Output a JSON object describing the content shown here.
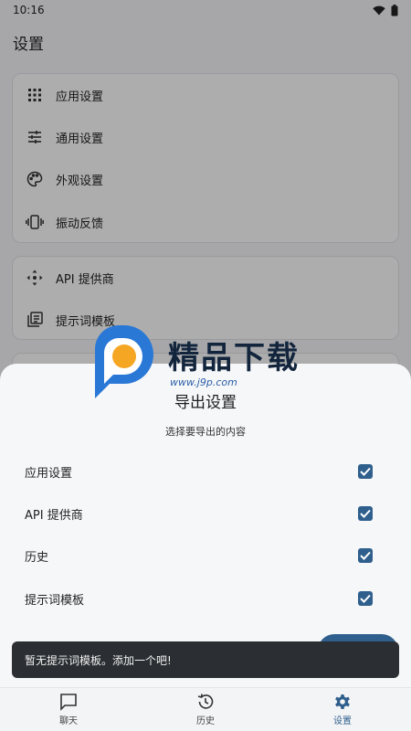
{
  "status_bar": {
    "time": "10:16"
  },
  "page": {
    "title": "设置"
  },
  "settings_card_1": {
    "items": [
      {
        "label": "应用设置",
        "icon": "grid-icon"
      },
      {
        "label": "通用设置",
        "icon": "sliders-icon"
      },
      {
        "label": "外观设置",
        "icon": "palette-icon"
      },
      {
        "label": "振动反馈",
        "icon": "vibration-icon"
      }
    ]
  },
  "settings_card_2": {
    "items": [
      {
        "label": "API 提供商",
        "icon": "api-icon"
      },
      {
        "label": "提示词模板",
        "icon": "template-icon"
      }
    ]
  },
  "watermark": {
    "brand": "精品下载",
    "url": "www.j9p.com"
  },
  "export_sheet": {
    "title": "导出设置",
    "subtitle": "选择要导出的内容",
    "options": [
      {
        "label": "应用设置",
        "checked": true
      },
      {
        "label": "API 提供商",
        "checked": true
      },
      {
        "label": "历史",
        "checked": true
      },
      {
        "label": "提示词模板",
        "checked": true
      }
    ]
  },
  "snackbar": {
    "message": "暂无提示词模板。添加一个吧!"
  },
  "bottom_nav": {
    "items": [
      {
        "label": "聊天",
        "icon": "chat-icon"
      },
      {
        "label": "历史",
        "icon": "history-icon"
      },
      {
        "label": "设置",
        "icon": "gear-icon",
        "active": true
      }
    ]
  },
  "colors": {
    "accent": "#2f5f8c",
    "scrim": "rgba(0,0,0,0.32)",
    "snackbar": "#2b2f33"
  }
}
